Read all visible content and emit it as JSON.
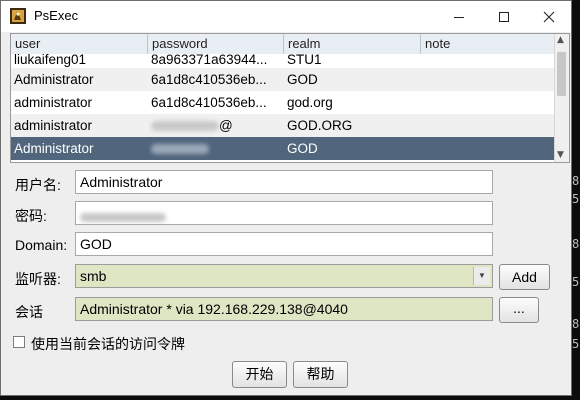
{
  "window": {
    "title": "PsExec"
  },
  "background": {
    "glyphs": [
      "8",
      "5",
      "8",
      "5",
      "8",
      "5"
    ]
  },
  "table": {
    "columns": [
      "user",
      "password",
      "realm",
      "note"
    ],
    "rows": [
      {
        "user": "liukaifeng01",
        "password": "8a963371a63944...",
        "realm": "STU1",
        "note": ""
      },
      {
        "user": "Administrator",
        "password": "6a1d8c410536eb...",
        "realm": "GOD",
        "note": ""
      },
      {
        "user": "administrator",
        "password": "6a1d8c410536eb...",
        "realm": "god.org",
        "note": ""
      },
      {
        "user": "administrator",
        "password": "@",
        "realm": "GOD.ORG",
        "note": ""
      },
      {
        "user": "Administrator",
        "password": "",
        "realm": "GOD",
        "note": ""
      }
    ],
    "selected_index": 4
  },
  "form": {
    "username_label": "用户名:",
    "username_value": "Administrator",
    "password_label": "密码:",
    "domain_label": "Domain:",
    "domain_value": "GOD",
    "listener_label": "监听器:",
    "listener_value": "smb",
    "add_label": "Add",
    "session_label": "会话",
    "session_value": "Administrator * via  192.168.229.138@4040",
    "session_browse_label": "...",
    "use_token_label": "使用当前会话的访问令牌",
    "use_token_checked": false
  },
  "buttons": {
    "start": "开始",
    "help": "帮助"
  },
  "colors": {
    "selected_row": "#51657d",
    "tinted_field": "#dfe6c4",
    "header": "#e9eef5"
  }
}
